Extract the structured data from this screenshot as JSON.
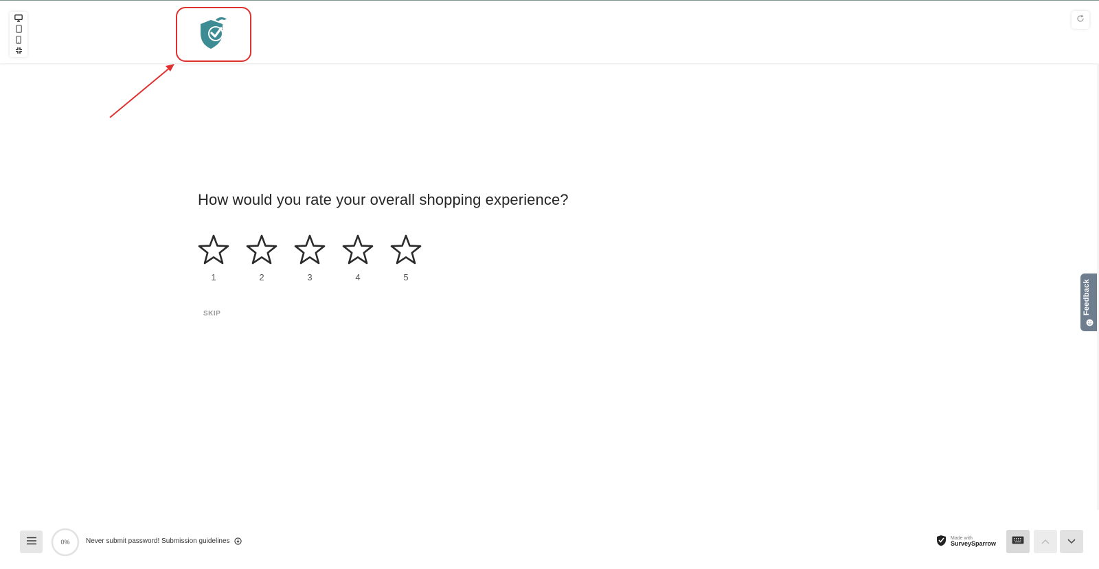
{
  "header": {
    "device_toolbar": [
      {
        "icon": "desktop-icon"
      },
      {
        "icon": "tablet-icon"
      },
      {
        "icon": "mobile-icon"
      },
      {
        "icon": "collapse-icon"
      }
    ],
    "logo_icon": "surveysparrow-logo-icon",
    "refresh_icon": "refresh-icon",
    "colors": {
      "logo": "#3d8b93",
      "highlight": "#e03131"
    }
  },
  "question": {
    "text": "How would you rate your overall shopping experience?",
    "rating": {
      "options": [
        "1",
        "2",
        "3",
        "4",
        "5"
      ],
      "selected": 0,
      "max": 5,
      "icon": "star-outline-icon"
    },
    "skip_label": "SKIP"
  },
  "feedback_tab": {
    "label": "Feedback",
    "icon": "smiley-icon"
  },
  "footer": {
    "menu_icon": "hamburger-icon",
    "progress": {
      "value": 0,
      "label": "0%"
    },
    "note": "Never submit password! Submission guidelines",
    "note_icon": "info-icon",
    "made_with": {
      "small": "Made with",
      "brand": "SurveySparrow"
    },
    "keyboard_icon": "keyboard-icon",
    "nav_up_icon": "chevron-up-icon",
    "nav_down_icon": "chevron-down-icon"
  }
}
